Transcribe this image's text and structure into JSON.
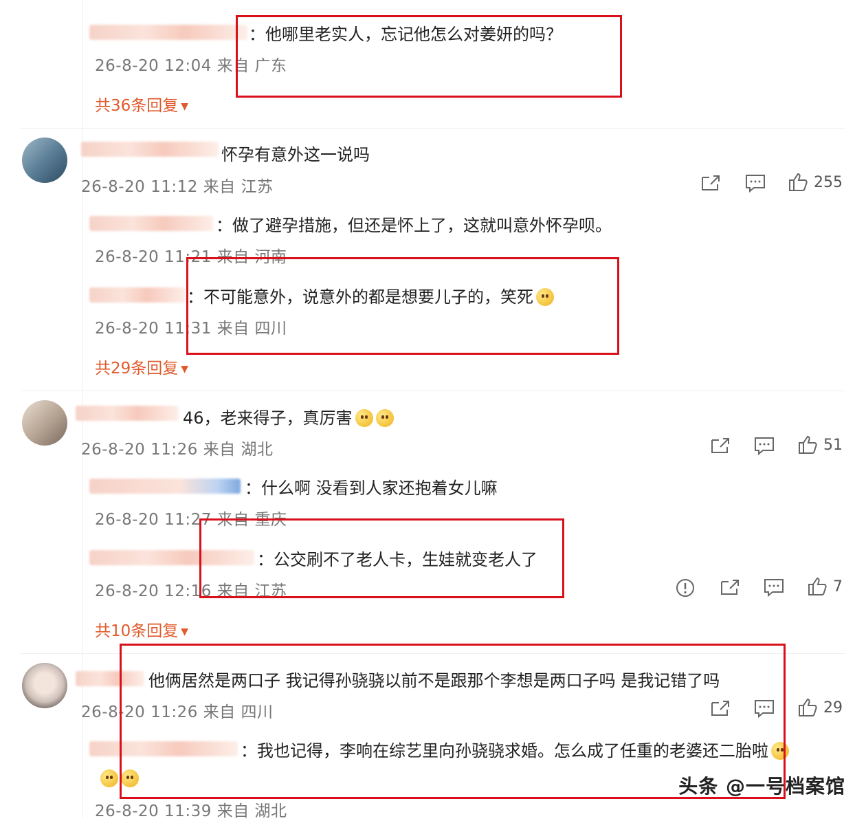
{
  "comments": [
    {
      "replies": [
        {
          "text": "他哪里老实人，忘记他怎么对姜妍的吗？",
          "meta": "26-8-20 12:04 来自 广东"
        }
      ],
      "reply_count_label": "共36条回复"
    },
    {
      "text": "怀孕有意外这一说吗",
      "meta": "26-8-20 11:12 来自 江苏",
      "likes": "255",
      "replies": [
        {
          "text": "做了避孕措施，但还是怀上了，这就叫意外怀孕呗。",
          "meta": "26-8-20 11:21 来自 河南"
        },
        {
          "text": "不可能意外，说意外的都是想要儿子的，笑死",
          "meta": "26-8-20 11:31 来自 四川"
        }
      ],
      "reply_count_label": "共29条回复"
    },
    {
      "text": "46，老来得子，真厉害",
      "meta": "26-8-20 11:26 来自 湖北",
      "likes": "51",
      "replies": [
        {
          "text": "什么啊 没看到人家还抱着女儿嘛",
          "meta": "26-8-20 11:27 来自 重庆"
        },
        {
          "text": "公交刷不了老人卡，生娃就变老人了",
          "meta": "26-8-20 12:16 来自 江苏",
          "likes": "7"
        }
      ],
      "reply_count_label": "共10条回复"
    },
    {
      "text": "他俩居然是两口子 我记得孙骁骁以前不是跟那个李想是两口子吗 是我记错了吗",
      "meta": "26-8-20 11:26 来自 四川",
      "likes": "29",
      "replies": [
        {
          "text": "我也记得，李响在综艺里向孙骁骁求婚。怎么成了任重的老婆还二胎啦",
          "meta": "26-8-20 11:39 来自 湖北"
        }
      ]
    }
  ],
  "watermark": "头条 @一号档案馆",
  "colors": {
    "highlight_box": "#d9101a",
    "reply_link": "#e05a2b",
    "meta": "#777777"
  },
  "icons": [
    "share-icon",
    "comment-icon",
    "like-icon",
    "report-icon",
    "caret-down-icon",
    "emoji-icon"
  ]
}
